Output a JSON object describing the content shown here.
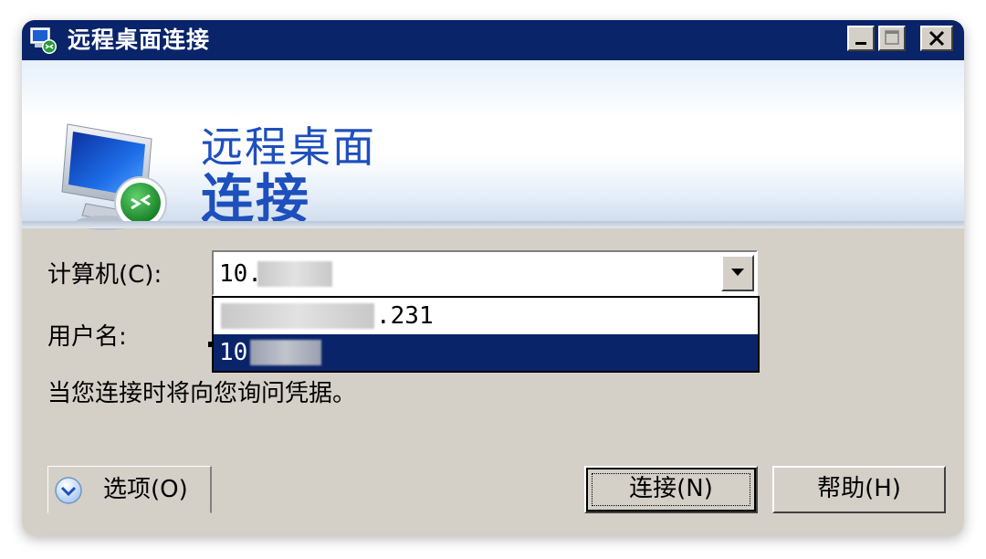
{
  "window": {
    "title": "远程桌面连接"
  },
  "banner": {
    "line1": "远程桌面",
    "line2": "连接"
  },
  "form": {
    "computer_label": "计算机(C):",
    "computer_value": "10.      .4",
    "user_label": "用户名:",
    "credentials_note": "当您连接时将向您询问凭据。"
  },
  "dropdown": {
    "options": [
      {
        "text": ".231",
        "selected": false
      },
      {
        "text": "10.     4.4",
        "selected": true
      }
    ]
  },
  "footer": {
    "options_label": "选项(O)",
    "connect_label": "连接(N)",
    "help_label": "帮助(H)"
  },
  "colors": {
    "titlebar": "#0a246a",
    "dialog_bg": "#d4d0c8",
    "banner_text": "#1d4fbd",
    "selection": "#0a246a"
  }
}
